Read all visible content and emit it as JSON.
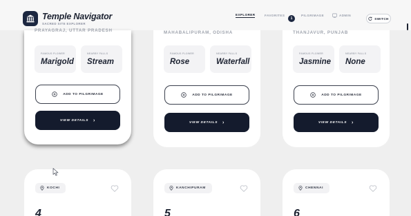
{
  "app": {
    "title": "Temple Navigator",
    "subtitle": "SACRED SITE EXPLORER",
    "colors": {
      "primary": "#1c2740",
      "background": "#efefef",
      "card": "#ffffff",
      "muted_text": "#9ea3ad"
    }
  },
  "nav": {
    "explorer": "EXPLORER",
    "favorites": "FAVORITES",
    "favorites_count": "1",
    "pilgrimage": "PILGRIMAGE",
    "admin": "ADMIN",
    "switch": "SWITCH"
  },
  "cards": [
    {
      "location": "PRAYAGRAJ, UTTAR PRADESH",
      "flower_label": "FAMOUS FLOWER",
      "flower": "Marigold",
      "falls_label": "NEARBY FALLS",
      "falls": "Stream",
      "add_label": "ADD TO PILGRIMAGE",
      "view_label": "VIEW DETAILS"
    },
    {
      "location": "MAHABALIPURAM, ODISHA",
      "flower_label": "FAMOUS FLOWER",
      "flower": "Rose",
      "falls_label": "NEARBY FALLS",
      "falls": "Waterfall",
      "add_label": "ADD TO PILGRIMAGE",
      "view_label": "VIEW DETAILS"
    },
    {
      "location": "THANJAVUR, PUNJAB",
      "flower_label": "FAMOUS FLOWER",
      "flower": "Jasmine",
      "falls_label": "NEARBY FALLS",
      "falls": "None",
      "add_label": "ADD TO PILGRIMAGE",
      "view_label": "VIEW DETAILS"
    }
  ],
  "cards_row2": [
    {
      "city": "KOCHI",
      "number": "4"
    },
    {
      "city": "KANCHIPURAM",
      "number": "5"
    },
    {
      "city": "CHENNAI",
      "number": "6"
    }
  ],
  "icons": [
    "temple-logo-icon",
    "favorites-count-badge",
    "pilgrimage-list-icon",
    "admin-icon",
    "switch-icon",
    "add-circle-icon",
    "chevron-right-icon",
    "location-pin-icon",
    "heart-icon",
    "mouse-cursor-icon"
  ]
}
